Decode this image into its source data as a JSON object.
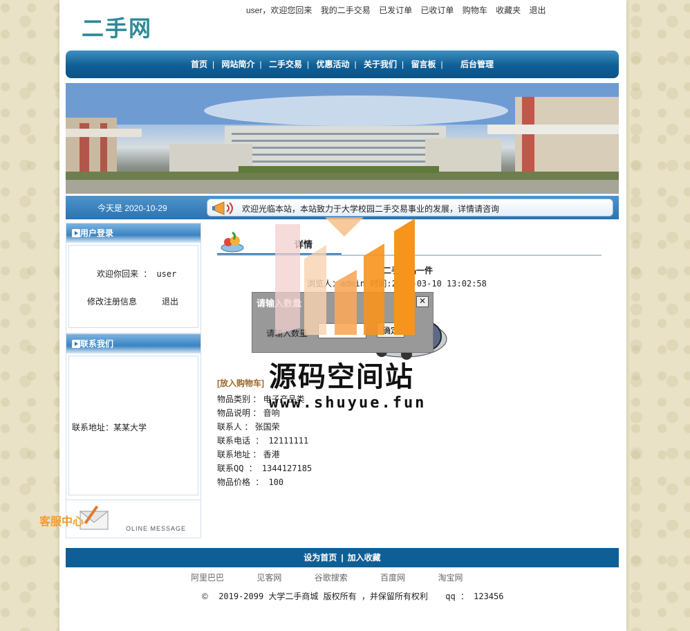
{
  "header": {
    "logo": "二手网",
    "welcome": "user，欢迎您回来",
    "links": [
      "我的二手交易",
      "已发订单",
      "已收订单",
      "购物车",
      "收藏夹",
      "退出"
    ]
  },
  "nav": {
    "items": [
      "首页",
      "网站简介",
      "二手交易",
      "优惠活动",
      "关于我们",
      "留言板",
      "后台管理"
    ],
    "separator": "|"
  },
  "ticker": {
    "date": "今天是 2020-10-29",
    "message": "欢迎光临本站，本站致力于大学校园二手交易事业的发展，详情请咨询"
  },
  "sidebar": {
    "login": {
      "title": "用户登录",
      "greeting": "欢迎你回来 ： user",
      "edit_link": "修改注册信息",
      "logout_link": "退出"
    },
    "contact": {
      "title": "联系我们",
      "address": "联系地址：某某大学"
    },
    "message_banner": "OLINE MESSAGE"
  },
  "detail": {
    "title": "详情",
    "item_name": "二手物品一件",
    "meta": "浏览人：admin  时间:2019-03-10 13:02:58",
    "add_to_cart": "[放入购物车]",
    "fields": {
      "category": "物品类别 ： 电子产品类",
      "description": "物品说明 ： 音响",
      "contact_person": "联系人 ： 张国荣",
      "phone": "联系电话 ： 12111111",
      "address": "联系地址 ： 香港",
      "qq": "联系QQ ： 1344127185",
      "price": "物品价格 ： 100"
    }
  },
  "dialog": {
    "title": "请输入数量",
    "label": "请输入数量",
    "input_value": "",
    "confirm": "确定",
    "close": "✕"
  },
  "overlay": {
    "watermark_title": "源码空间站",
    "watermark_url": "www.shuyue.fun",
    "service_center": "客服中心"
  },
  "footer": {
    "bar_links": [
      "设为首页",
      "加入收藏"
    ],
    "friend_links": [
      "阿里巴巴",
      "见客网",
      "谷歌搜索",
      "百度网",
      "淘宝网"
    ],
    "copyright_symbol": "©",
    "copyright": "2019-2099 大学二手商城 版权所有 ，并保留所有权利",
    "qq": "qq ： 123456"
  },
  "colors": {
    "nav_blue": "#0f5f96",
    "logo_teal": "#2f8a98",
    "watermark_orange": "#f7941d",
    "service_orange": "#f39c2c"
  }
}
